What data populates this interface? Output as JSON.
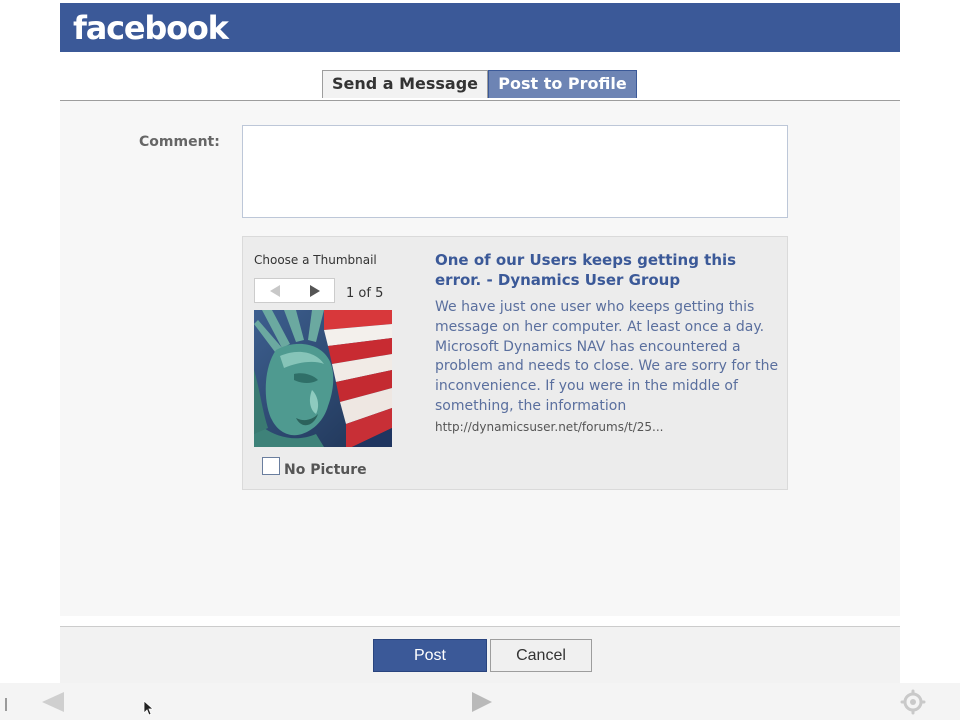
{
  "header": {
    "logo": "facebook",
    "color": "#3b5998"
  },
  "tabs": [
    {
      "label": "Send a Message",
      "active": false
    },
    {
      "label": "Post to Profile",
      "active": true
    }
  ],
  "form": {
    "comment_label": "Comment:",
    "comment_value": "",
    "comment_placeholder": ""
  },
  "attachment": {
    "choose_label": "Choose a Thumbnail",
    "count": "1 of 5",
    "thumbnail_icon": "statue-of-liberty-flag-image",
    "no_picture_label": "No Picture",
    "no_picture_checked": false,
    "title": "One of our Users keeps getting this error. - Dynamics User Group",
    "description": "We have just one user who keeps getting this message on her computer. At least once a day. Microsoft Dynamics NAV has encountered a problem and needs to close. We are sorry for the inconvenience. If you were in the middle of something, the information",
    "url": "http://dynamicsuser.net/forums/t/25..."
  },
  "buttons": {
    "post": "Post",
    "cancel": "Cancel"
  },
  "player": {
    "prev_icon": "triangle-left-icon",
    "play_icon": "play-icon",
    "settings_icon": "gear-icon"
  }
}
